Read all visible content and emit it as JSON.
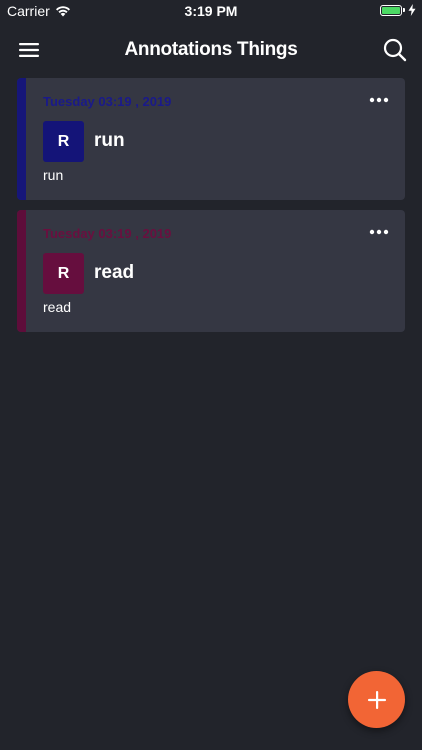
{
  "status_bar": {
    "carrier": "Carrier",
    "time": "3:19 PM",
    "battery_color": "#4cd964"
  },
  "nav": {
    "title": "Annotations Things",
    "menu_icon": "hamburger-menu-icon",
    "search_icon": "search-icon"
  },
  "notes": [
    {
      "date": "Tuesday 03:19 , 2019",
      "avatar_letter": "R",
      "title": "run",
      "body": "run",
      "accent_color": "#161679",
      "date_color": "#1a1a8a",
      "avatar_color": "#141478"
    },
    {
      "date": "Tuesday 03:19 , 2019",
      "avatar_letter": "R",
      "title": "read",
      "body": "read",
      "accent_color": "#5e0d3a",
      "date_color": "#6a0f3f",
      "avatar_color": "#660e3e"
    }
  ],
  "fab": {
    "icon": "plus-icon",
    "color": "#f26535"
  },
  "colors": {
    "background": "#22242b",
    "card": "#353743"
  }
}
